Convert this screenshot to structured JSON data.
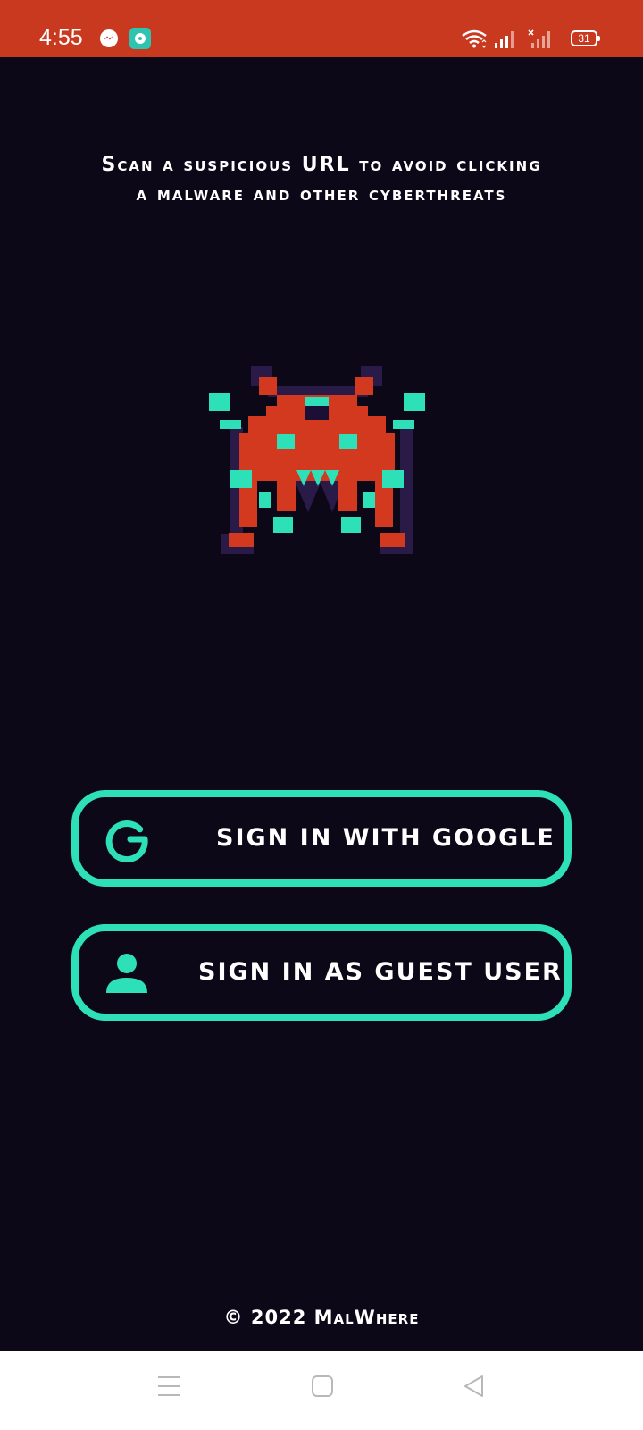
{
  "status_bar": {
    "time": "4:55",
    "battery": "31",
    "icons": [
      "messenger-icon",
      "chat-app-icon",
      "wifi-icon",
      "signal-icon",
      "signal-no-service-icon",
      "battery-icon"
    ],
    "background_color": "#c9391f"
  },
  "main": {
    "tagline": "Scan a suspicious URL to avoid clicking a malware and other cyberthreats",
    "mascot_icon": "space-invader-malware-icon",
    "buttons": {
      "google": {
        "label": "SIGN IN WITH GOOGLE",
        "icon": "google-g-icon"
      },
      "guest": {
        "label": "SIGN IN AS GUEST USER",
        "icon": "user-icon"
      }
    },
    "copyright": "© 2022 MalWhere"
  },
  "nav_bar": {
    "icons": [
      "menu-icon",
      "home-icon",
      "back-icon"
    ]
  },
  "colors": {
    "background": "#0d0818",
    "accent": "#2ee0b8",
    "brand_red": "#c9391f",
    "shadow_purple": "#2a1a48",
    "text": "#ffffff"
  }
}
